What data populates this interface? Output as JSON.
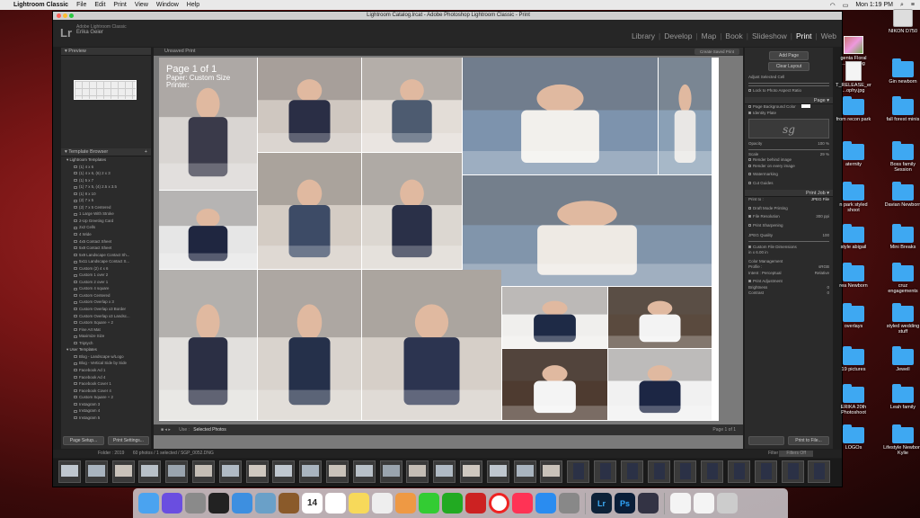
{
  "menubar": {
    "app": "Lightroom Classic",
    "items": [
      "File",
      "Edit",
      "Print",
      "View",
      "Window",
      "Help"
    ],
    "time": "Mon 1:19 PM"
  },
  "window": {
    "title": "Lightroom Catalog.lrcat - Adobe Photoshop Lightroom Classic - Print"
  },
  "identity": {
    "product": "Adobe Lightroom Classic",
    "user": "Erika Geier",
    "logo": "Lr"
  },
  "modules": [
    "Library",
    "Develop",
    "Map",
    "Book",
    "Slideshow",
    "Print",
    "Web"
  ],
  "active_module": "Print",
  "left": {
    "preview_label": "Preview",
    "template_browser_label": "Template Browser",
    "lightroom_templates_label": "Lightroom Templates",
    "templates": [
      "(1) 4 x 6",
      "(1) 4 x 6, (6) 2 x 3",
      "(1) 5 x 7",
      "(1) 7 x 5, (4) 2.5 x 3.5",
      "(1) 8 x 10",
      "(2) 7 x 5",
      "(2) 7 x 5 Centered",
      "1 Large With Stroke",
      "2-Up Greeting Card",
      "2x2 Cells",
      "4 Wide",
      "4x5 Contact Sheet",
      "5x8 Contact Sheet",
      "5x9 Landscape Contact Sh...",
      "5x11 Landscape Contact S...",
      "Custom (2) 4 x 6",
      "Custom 1 over 2",
      "Custom 2 over 1",
      "Custom 4 square",
      "Custom Centered",
      "Custom Overlap x 3",
      "Custom Overlap x3 Border",
      "Custom Overlap x3 Landsc...",
      "Custom Square + 2",
      "Fine Art Mat",
      "Maximize Size",
      "Triptych"
    ],
    "user_templates_label": "User Templates",
    "user_templates": [
      "Blog - Landscape w/Logo",
      "Blog - Vertical Side by Side",
      "Facebook Ad 1",
      "Facebook Ad 4",
      "Facebook Cover 1",
      "Facebook Cover 4",
      "Custom Square + 2",
      "Instagram 3",
      "Instagram 4",
      "Instagram 5"
    ],
    "page_setup": "Page Setup...",
    "print_settings": "Print Settings..."
  },
  "center": {
    "header": "Unsaved Print",
    "create_saved": "Create Saved Print",
    "page_title": "Page 1 of 1",
    "paper": "Paper:  Custom Size",
    "printer": "Printer:",
    "use_label": "Use :",
    "use_value": "Selected Photos",
    "page_count": "Page 1 of 1"
  },
  "right": {
    "add_page": "Add Page",
    "clear_layout": "Clear Layout",
    "adjust_selected": "Adjust Selected Cell",
    "lock_photo": "Lock to Photo Aspect Ratio",
    "page_section": "Page",
    "page_bg": "Page Background Color",
    "identity_plate": "Identity Plate",
    "plate_text": "sg",
    "opacity_label": "Opacity",
    "opacity_value": "100 %",
    "scale_label": "Scale",
    "scale_value": "29 %",
    "render_behind": "Render behind image",
    "render_every": "Render on every image",
    "watermarking": "Watermarking",
    "cut_guides": "Cut Guides",
    "print_job": "Print Job",
    "print_to_label": "Print to :",
    "print_to_value": "JPEG File",
    "draft_mode": "Draft Mode Printing",
    "file_res": "File Resolution",
    "file_res_value": "300 ppi",
    "print_sharpen": "Print Sharpening",
    "jpeg_quality": "JPEG Quality",
    "jpeg_value": "100",
    "custom_dims": "Custom File Dimensions",
    "dims_value": "in x 6.00 in",
    "color_mgmt": "Color Management",
    "profile_label": "Profile :",
    "profile_value": "sRGB",
    "intent_label": "Intent :",
    "intent_a": "Perceptual",
    "intent_b": "Relative",
    "print_adj": "Print Adjustment",
    "brightness": "Brightness",
    "brightness_value": "0",
    "contrast": "Contrast",
    "contrast_value": "0",
    "print_to_file": "Print to File..."
  },
  "filmstrip": {
    "folder": "Folder : 2019",
    "count": "60 photos / 1 selected / SGP_0052.DNG",
    "filter_label": "Filter :",
    "filter_value": "Filters Off"
  },
  "desktop_icons": [
    {
      "label": "NIKON D750",
      "kind": "drive"
    },
    {
      "label": "genta Floral ...ffage.jpg",
      "kind": "pic"
    },
    {
      "label": "T_RELEASE_er ...ophy.jpg",
      "kind": "doc"
    },
    {
      "label": "Gin newborn",
      "kind": "folder"
    },
    {
      "label": "from recon park",
      "kind": "folder"
    },
    {
      "label": "fall forest minis",
      "kind": "folder"
    },
    {
      "label": "aternity",
      "kind": "folder"
    },
    {
      "label": "Boss family Session",
      "kind": "folder"
    },
    {
      "label": "n park styled shoot",
      "kind": "folder"
    },
    {
      "label": "Davian Newborn",
      "kind": "folder"
    },
    {
      "label": "style abigail",
      "kind": "folder"
    },
    {
      "label": "Mini Breaks",
      "kind": "folder"
    },
    {
      "label": "rea Newborn",
      "kind": "folder"
    },
    {
      "label": "cruz engagements",
      "kind": "folder"
    },
    {
      "label": "overlays",
      "kind": "folder"
    },
    {
      "label": "styled wedding stuff",
      "kind": "folder"
    },
    {
      "label": "19 pictures",
      "kind": "folder"
    },
    {
      "label": "Jewell",
      "kind": "folder"
    },
    {
      "label": "ERIKA 20th Photoshoot",
      "kind": "folder"
    },
    {
      "label": "Leah family",
      "kind": "folder"
    },
    {
      "label": "LOGOs",
      "kind": "folder"
    },
    {
      "label": "Lifestyle Newborn Kylie",
      "kind": "folder"
    }
  ],
  "dock": {
    "calendar_day": "14",
    "apps": [
      "finder",
      "siri",
      "launchpad",
      "dashboard",
      "safari",
      "preview",
      "notes-brown",
      "calendar",
      "reminders",
      "notes",
      "photos",
      "photos-color",
      "messages",
      "facetime",
      "photobooth",
      "no-entry",
      "music",
      "app-store",
      "system-prefs",
      "lightroom",
      "photoshop",
      "quicktime",
      "documents",
      "preview-doc",
      "trash"
    ]
  },
  "colors": {
    "accent": "#ffffff",
    "panel": "#2b2b2b",
    "bg": "#7a7a7a",
    "folder": "#3ea8f2"
  }
}
